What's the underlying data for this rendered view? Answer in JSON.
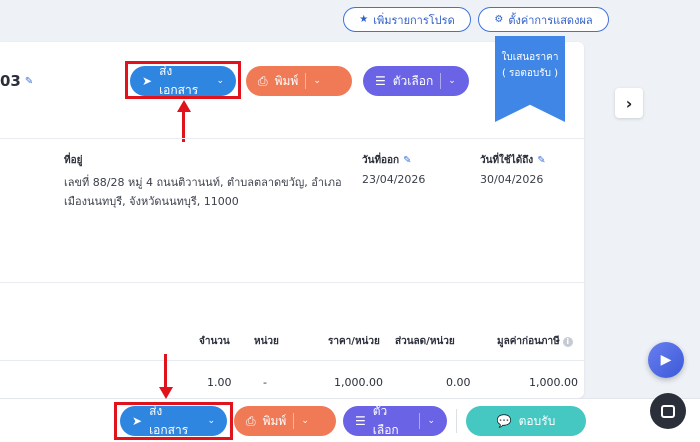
{
  "top_actions": {
    "add_promo": "เพิ่มรายการโปรด",
    "display_settings": "ตั้งค่าการแสดงผล"
  },
  "doc": {
    "number_suffix": "03"
  },
  "actions": {
    "send": "ส่งเอกสาร",
    "print": "พิมพ์",
    "options": "ตัวเลือก",
    "reply": "ตอบรับ"
  },
  "ribbon": {
    "line1": "ใบเสนอราคา",
    "line2": "( รอตอบรับ )"
  },
  "details": {
    "address_label": "ที่อยู่",
    "address_line1": "เลขที่ 88/28 หมู่ 4 ถนนติวานนท์, ตำบลตลาดขวัญ, อำเภอ",
    "address_line2": "เมืองนนทบุรี, จังหวัดนนทบุรี, 11000",
    "issue_date_label": "วันที่ออก",
    "issue_date": "23/04/2026",
    "valid_until_label": "วันที่ใช้ได้ถึง",
    "valid_until": "30/04/2026"
  },
  "table": {
    "headers": [
      "จำนวน",
      "หน่วย",
      "ราคา/หน่วย",
      "ส่วนลด/หน่วย",
      "มูลค่าก่อนภาษี"
    ],
    "row": [
      "1.00",
      "-",
      "1,000.00",
      "0.00",
      "1,000.00"
    ]
  },
  "colors": {
    "send": "#2e86e0",
    "print": "#f07a56",
    "options": "#6a63e6",
    "reply": "#45c7c2",
    "highlight": "#e0121b"
  }
}
